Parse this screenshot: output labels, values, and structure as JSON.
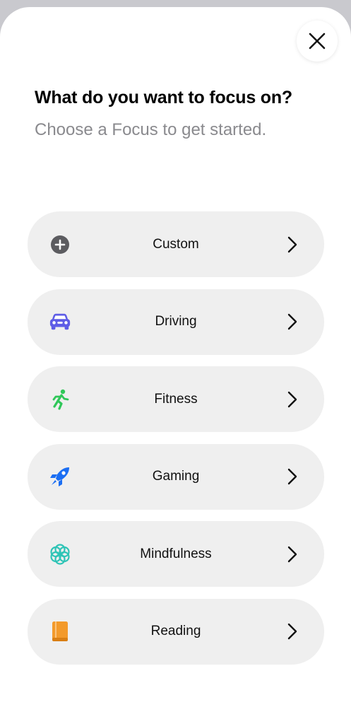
{
  "header": {
    "title": "What do you want to focus on?",
    "subtitle": "Choose a Focus to get started."
  },
  "close_icon": "close-icon",
  "focus_options": [
    {
      "label": "Custom",
      "icon": "plus-circle-icon",
      "color": "#5c5c60"
    },
    {
      "label": "Driving",
      "icon": "car-icon",
      "color": "#5e5ce6"
    },
    {
      "label": "Fitness",
      "icon": "running-figure-icon",
      "color": "#30c759"
    },
    {
      "label": "Gaming",
      "icon": "rocket-icon",
      "color": "#1b6ef3"
    },
    {
      "label": "Mindfulness",
      "icon": "flower-icon",
      "color": "#2ec4b6"
    },
    {
      "label": "Reading",
      "icon": "book-icon",
      "color": "#f39a2b"
    }
  ]
}
